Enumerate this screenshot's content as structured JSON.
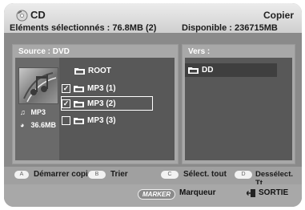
{
  "header": {
    "title": "CD",
    "menu": "Copier",
    "selected": "Eléments sélectionnés : 76.8MB  (2)",
    "available": "Disponible : 236715MB"
  },
  "source": {
    "label": "Source : DVD",
    "file_type": "MP3",
    "file_size": "36.6MB",
    "items": [
      {
        "name": "ROOT",
        "checked": false
      },
      {
        "name": "MP3 (1)",
        "checked": true
      },
      {
        "name": "MP3 (2)",
        "checked": true
      },
      {
        "name": "MP3 (3)",
        "checked": false
      }
    ]
  },
  "destination": {
    "label": "Vers :",
    "items": [
      {
        "name": "DD"
      }
    ]
  },
  "buttons": [
    {
      "key": "A",
      "label": "Démarrer copie"
    },
    {
      "key": "B",
      "label": "Trier"
    },
    {
      "key": "C",
      "label": "Sélect. tout"
    },
    {
      "key": "D",
      "label": "Dessélect. Tt"
    }
  ],
  "footer": {
    "marker_key": "MARKER",
    "marker_label": "Marqueur",
    "exit_label": "SORTIE"
  },
  "colors": {
    "background": "#8a8a8a",
    "titlebar": "#e0e0e0",
    "panel": "#a8a8a8",
    "list": "#585858"
  }
}
